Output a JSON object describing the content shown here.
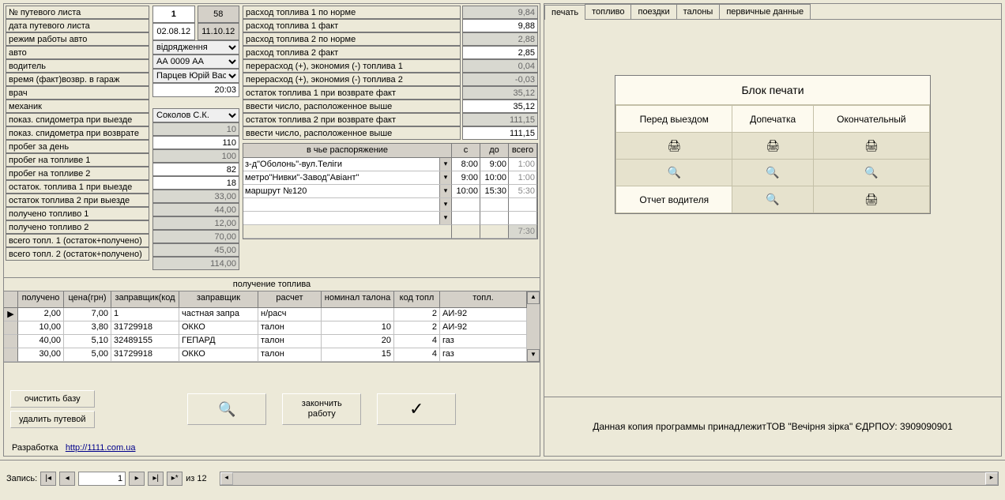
{
  "labels": {
    "waybill_no": "№ путевого листа",
    "waybill_date": "дата путевого листа",
    "mode": "режим работы авто",
    "auto": "авто",
    "driver": "водитель",
    "return_time": "время (факт)возвр. в гараж",
    "doctor": "врач",
    "mechanic": "механик",
    "spd_out": "показ. спидометра при выезде",
    "spd_in": "показ. спидометра при возврате",
    "day_run": "пробег за день",
    "run_fuel1": "пробег на топливе 1",
    "run_fuel2": "пробег на топливе 2",
    "rest1_out": "остаток. топлива 1 при выезде",
    "rest2_out": "остаток топлива 2 при выезде",
    "got_fuel1": "получено топливо 1",
    "got_fuel2": "получено топливо 2",
    "total1": "всего топл. 1 (остаток+получено)",
    "total2": "всего топл. 2 (остаток+получено)"
  },
  "vals": {
    "wb_num_a": "1",
    "wb_num_b": "58",
    "date1": "02.08.12",
    "date2": "11.10.12",
    "mode": "відрядження",
    "auto": "АА 0009 АА",
    "driver": "Парцев Юрій Васи.",
    "return_time": "20:03",
    "mechanic": "Соколов С.К.",
    "spd_out": "10",
    "spd_in": "110",
    "day_run": "100",
    "run_fuel1": "82",
    "run_fuel2": "18",
    "rest1_out": "33,00",
    "rest2_out": "44,00",
    "got_fuel1": "12,00",
    "got_fuel2": "70,00",
    "total1": "45,00",
    "total2": "114,00"
  },
  "fuelrows": {
    "l0": "расход топлива 1 по норме",
    "v0": "9,84",
    "l1": "расход топлива 1 факт",
    "v1": "9,88",
    "l2": "расход топлива 2 по норме",
    "v2": "2,88",
    "l3": "расход топлива 2 факт",
    "v3": "2,85",
    "l4": "перерасход (+), экономия (-) топлива 1",
    "v4": "0,04",
    "l5": "перерасход (+), экономия (-) топлива 2",
    "v5": "-0,03",
    "l6": "остаток топлива 1 при возврате факт",
    "v6": "35,12",
    "l7": "ввести число, расположенное выше",
    "v7": "35,12",
    "l8": "остаток топлива 2 при возврате факт",
    "v8": "111,15",
    "l9": "ввести число, расположенное выше",
    "v9": "111,15"
  },
  "disp": {
    "head": {
      "title": "в чье распоряжение",
      "c": "с",
      "d": "до",
      "t": "всего"
    },
    "rows": [
      {
        "name": "з-д\"Оболонь\"-вул.Теліги",
        "c": "8:00",
        "d": "9:00",
        "t": "1:00"
      },
      {
        "name": "метро\"Нивки\"-Завод\"Авіант\"",
        "c": "9:00",
        "d": "10:00",
        "t": "1:00"
      },
      {
        "name": "маршрут №120",
        "c": "10:00",
        "d": "15:30",
        "t": "5:30"
      },
      {
        "name": "",
        "c": "",
        "d": "",
        "t": ""
      },
      {
        "name": "",
        "c": "",
        "d": "",
        "t": ""
      }
    ],
    "sum": "7:30"
  },
  "fueltbl": {
    "title": "получение топлива",
    "cols": {
      "got": "получено",
      "price": "цена(грн)",
      "fcode": "заправщик(код",
      "fname": "заправщик",
      "calc": "расчет",
      "nominal": "номинал талона",
      "tcode": "код топл",
      "tname": "топл."
    },
    "rows": [
      {
        "got": "2,00",
        "price": "7,00",
        "fcode": "1",
        "fname": "частная запра",
        "calc": "н/расч",
        "nominal": "",
        "tcode": "2",
        "tname": "АИ-92"
      },
      {
        "got": "10,00",
        "price": "3,80",
        "fcode": "31729918",
        "fname": "ОККО",
        "calc": "талон",
        "nominal": "10",
        "tcode": "2",
        "tname": "АИ-92"
      },
      {
        "got": "40,00",
        "price": "5,10",
        "fcode": "32489155",
        "fname": "ГЕПАРД",
        "calc": "талон",
        "nominal": "20",
        "tcode": "4",
        "tname": "газ"
      },
      {
        "got": "30,00",
        "price": "5,00",
        "fcode": "31729918",
        "fname": "ОККО",
        "calc": "талон",
        "nominal": "15",
        "tcode": "4",
        "tname": "газ"
      }
    ]
  },
  "buttons": {
    "clear": "очистить базу",
    "delete": "удалить путевой",
    "finish": "закончить работу"
  },
  "credits": {
    "label": "Разработка",
    "link": "http://1111.com.ua"
  },
  "tabs": [
    "печать",
    "топливо",
    "поездки",
    "талоны",
    "первичные данные"
  ],
  "printblock": {
    "title": "Блок печати",
    "h1": "Перед выездом",
    "h2": "Допечатка",
    "h3": "Окончательный",
    "driver_report": "Отчет водителя"
  },
  "footer": "Данная копия программы принадлежитТОВ \"Вечірня зірка\"    ЄДРПОУ: 3909090901",
  "status": {
    "label": "Запись:",
    "cur": "1",
    "total": "из  12"
  }
}
